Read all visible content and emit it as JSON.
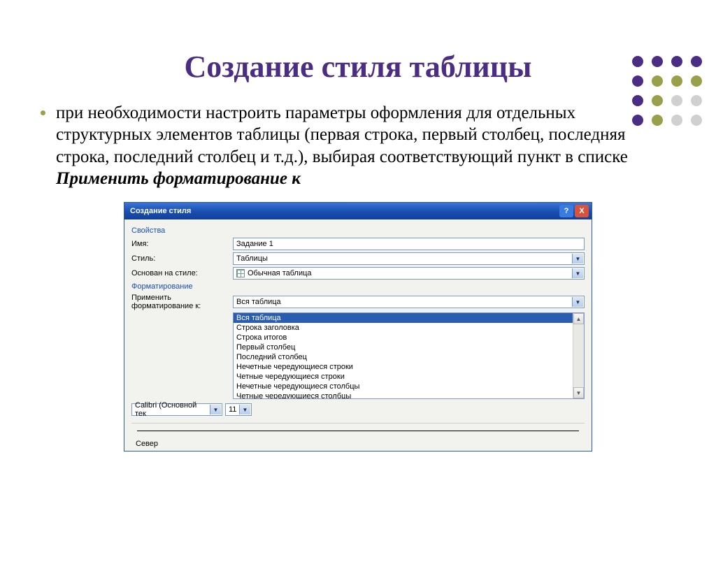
{
  "slide": {
    "title": "Создание стиля таблицы",
    "bullet_text": "при необходимости настроить параметры оформления для отдельных структурных элементов таблицы (первая строка, первый столбец, последняя строка, последний столбец и т.д.), выбирая соответствующий пункт в списке ",
    "bullet_emph": "Применить форматирование к"
  },
  "dialog": {
    "title": "Создание стиля",
    "help": "?",
    "close": "X",
    "section_props": "Свойства",
    "label_name": "Имя:",
    "value_name": "Задание 1",
    "label_style": "Стиль:",
    "value_style": "Таблицы",
    "label_based": "Основан на стиле:",
    "value_based": "Обычная таблица",
    "section_fmt": "Форматирование",
    "label_apply": "Применить форматирование к:",
    "value_apply": "Вся таблица",
    "options": [
      "Вся таблица",
      "Строка заголовка",
      "Строка итогов",
      "Первый столбец",
      "Последний столбец",
      "Нечетные чередующиеся строки",
      "Четные чередующиеся строки",
      "Нечетные чередующиеся столбцы",
      "Четные чередующиеся столбцы"
    ],
    "font_name": "Calibri (Основной тек",
    "font_size": "11",
    "preview_label": "Север"
  }
}
